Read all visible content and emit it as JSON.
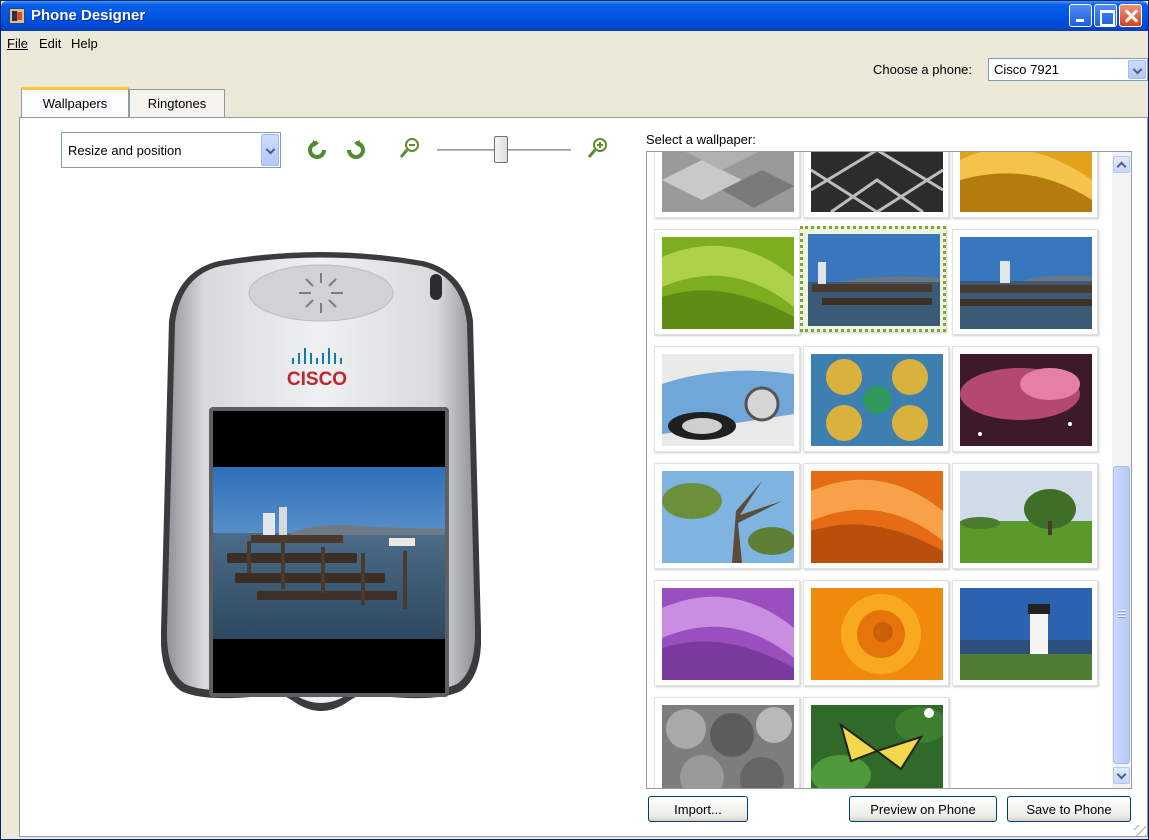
{
  "window": {
    "title": "Phone Designer"
  },
  "menu": {
    "file": "File",
    "edit": "Edit",
    "help": "Help"
  },
  "phone_chooser": {
    "label": "Choose a phone:",
    "selected": "Cisco 7921"
  },
  "tabs": [
    {
      "label": "Wallpapers",
      "active": true
    },
    {
      "label": "Ringtones",
      "active": false
    }
  ],
  "toolbar": {
    "mode_selected": "Resize and position",
    "icons": [
      "rotate-left-icon",
      "rotate-right-icon",
      "zoom-out-icon",
      "zoom-in-icon"
    ],
    "zoom_level": 0.5
  },
  "phone_preview": {
    "brand_text": "CISCO",
    "wallpaper": "pier-sea-lions"
  },
  "gallery": {
    "label": "Select a wallpaper:",
    "items": [
      {
        "name": "gray-tiles"
      },
      {
        "name": "kaleidoscope-bw"
      },
      {
        "name": "gold-swirl"
      },
      {
        "name": "green-swirl"
      },
      {
        "name": "pier-sea-lions",
        "selected": true
      },
      {
        "name": "pier-sea-lions-2"
      },
      {
        "name": "blue-car"
      },
      {
        "name": "kaleidoscope-color"
      },
      {
        "name": "pink-nebula"
      },
      {
        "name": "tree-sky"
      },
      {
        "name": "orange-swirl"
      },
      {
        "name": "green-landscape"
      },
      {
        "name": "purple-swirl"
      },
      {
        "name": "orange-rose"
      },
      {
        "name": "lighthouse"
      },
      {
        "name": "gray-succulents"
      },
      {
        "name": "butterfly"
      }
    ]
  },
  "buttons": {
    "import": "Import...",
    "preview": "Preview on Phone",
    "save": "Save to Phone"
  },
  "colors": {
    "titlebar": "#0055e5",
    "selection": "#7fa33b",
    "accent_tab": "#ffc83c"
  }
}
